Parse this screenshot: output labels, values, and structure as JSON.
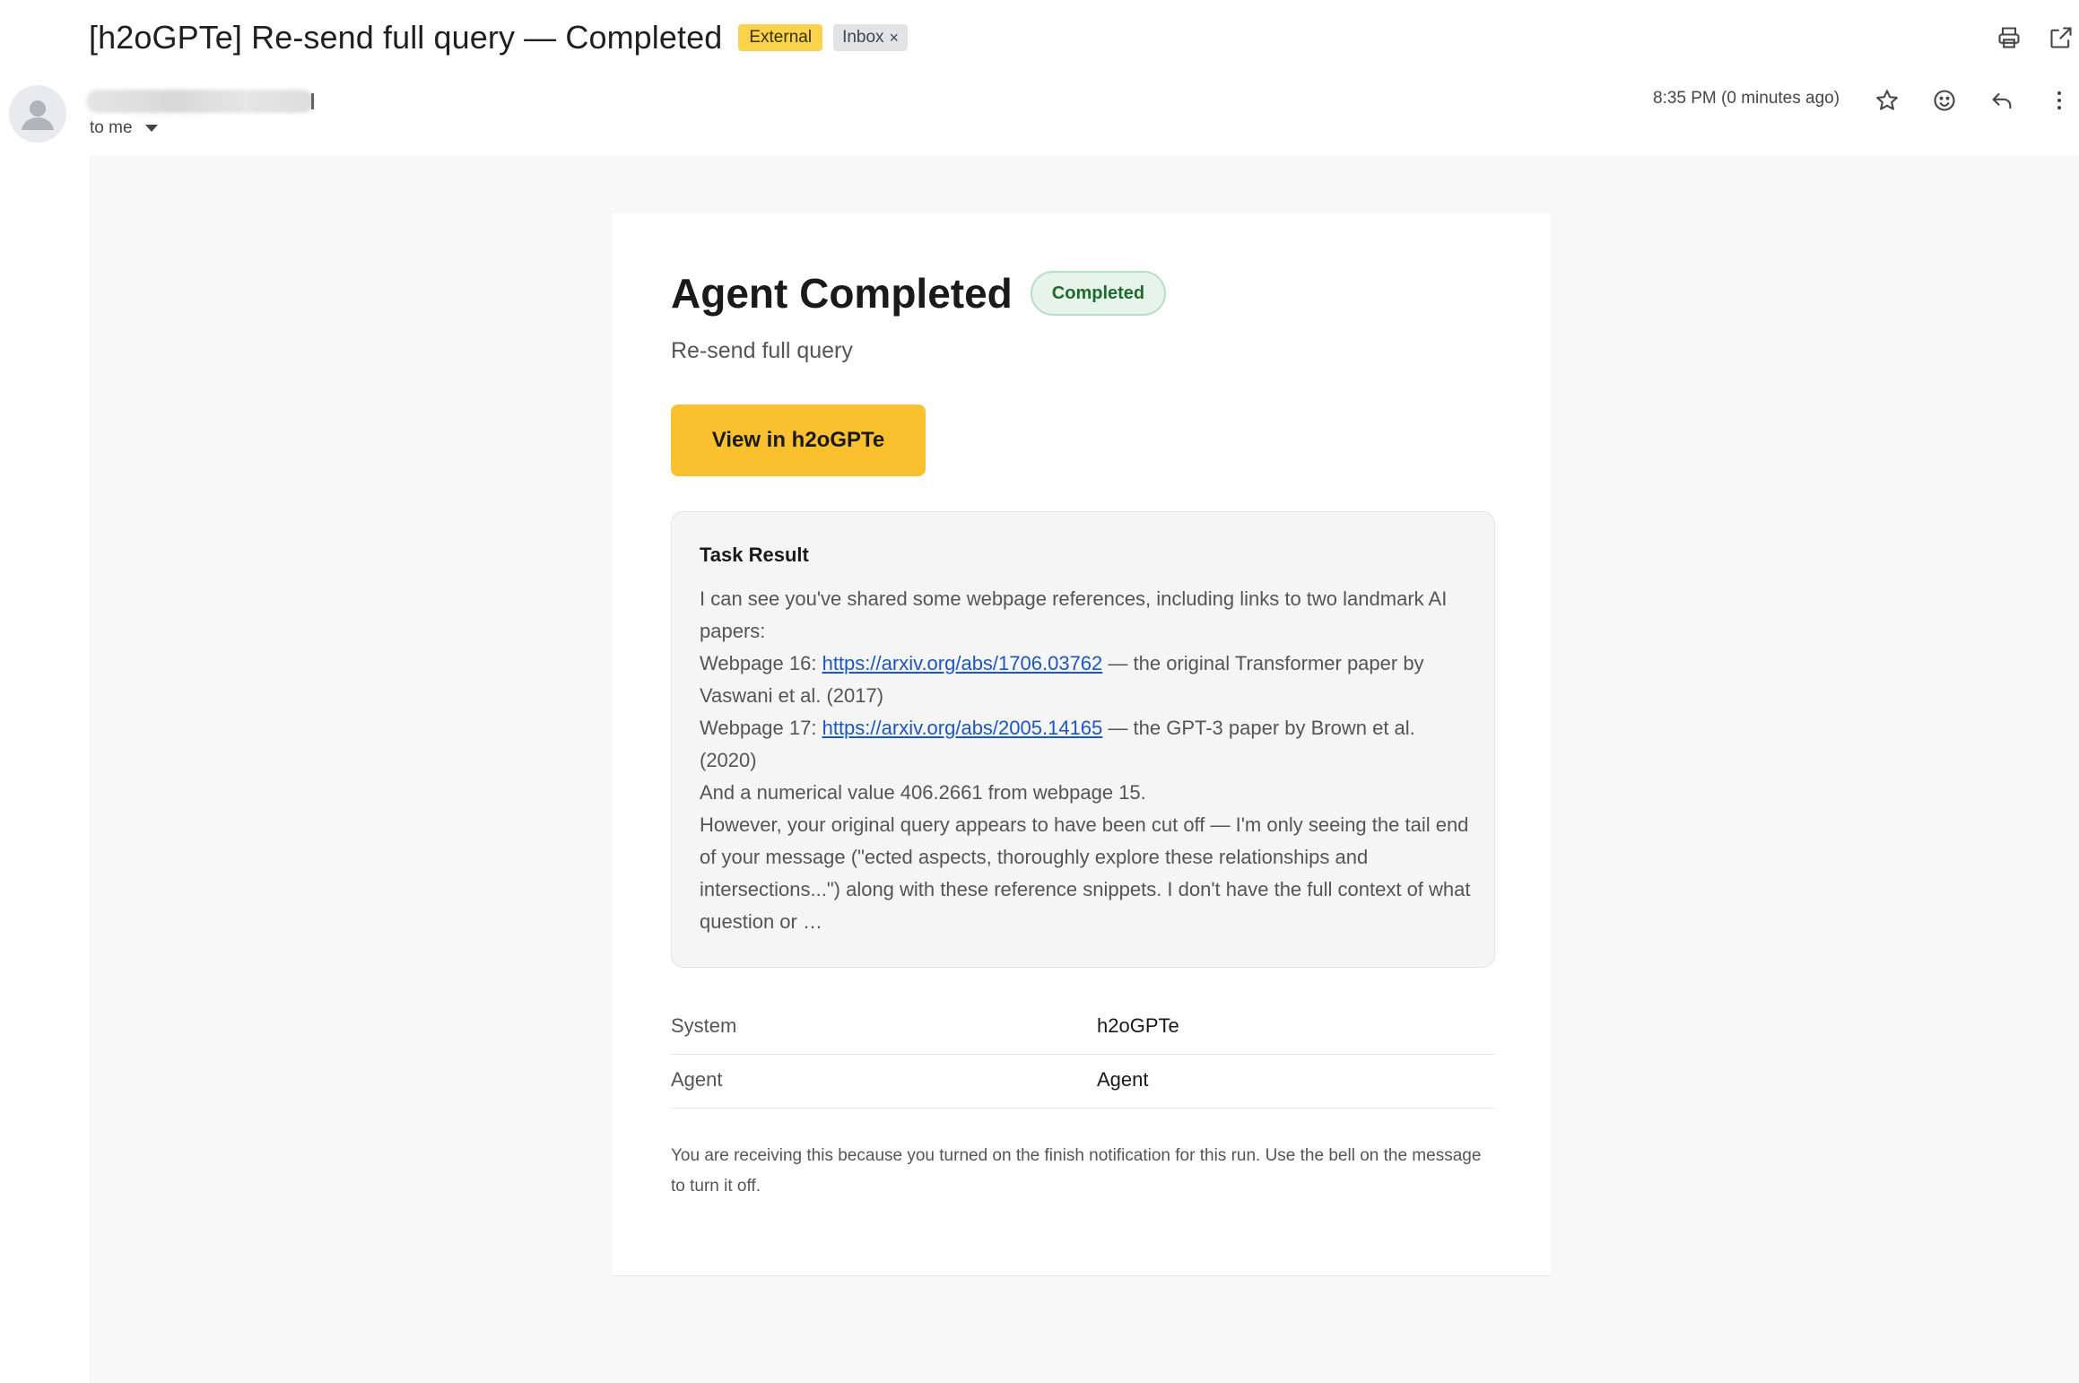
{
  "header": {
    "subject": "[h2oGPTe] Re-send full query — Completed",
    "labels": {
      "external": "External",
      "inbox": "Inbox",
      "remove_icon": "×"
    },
    "icons": [
      "print-icon",
      "open-in-new-window-icon",
      "star-icon",
      "emoji-reaction-icon",
      "reply-icon",
      "more-options-icon"
    ]
  },
  "message": {
    "recipient": "to me",
    "timestamp": "8:35 PM (0 minutes ago)"
  },
  "email": {
    "title": "Agent Completed",
    "status": "Completed",
    "subtitle": "Re-send full query",
    "cta_label": "View in h2oGPTe",
    "result": {
      "heading": "Task Result",
      "intro": "I can see you've shared some webpage references, including links to two landmark AI papers:",
      "webpage16_prefix": "Webpage 16: ",
      "webpage16_link": "https://arxiv.org/abs/1706.03762",
      "webpage16_suffix": " — the original Transformer paper by Vaswani et al. (2017)",
      "webpage17_prefix": "Webpage 17: ",
      "webpage17_link": "https://arxiv.org/abs/2005.14165",
      "webpage17_suffix": " — the GPT-3 paper by Brown et al. (2020)",
      "numeric_line": "And a numerical value 406.2661 from webpage 15.",
      "closing": "However, your original query appears to have been cut off — I'm only seeing the tail end of your message (\"ected aspects, thoroughly explore these relationships and intersections...\") along with these reference snippets. I don't have the full context of what question or …"
    },
    "meta": [
      {
        "key": "System",
        "value": "h2oGPTe"
      },
      {
        "key": "Agent",
        "value": "Agent"
      }
    ],
    "footer": "You are receiving this because you turned on the finish notification for this run. Use the bell on the message to turn it off."
  },
  "colors": {
    "external_label": "#fad24b",
    "inbox_label": "#e2e3e5",
    "cta_button": "#fbc02d",
    "status_pill_bg": "#e6f4ea",
    "status_pill_text": "#1e6b30",
    "link": "#1a56c4",
    "canvas": "#f8f8f8"
  }
}
